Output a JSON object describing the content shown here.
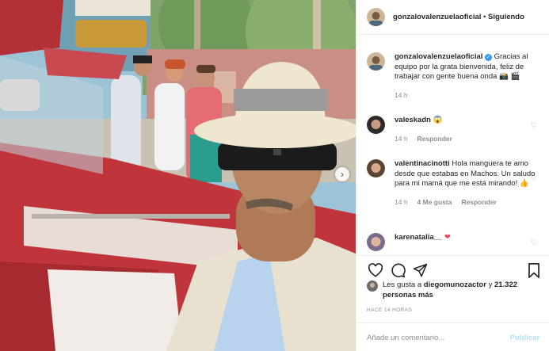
{
  "post": {
    "username": "gonzalovalenzuelaoficial",
    "follow_separator": "•",
    "follow_status": "Siguiendo"
  },
  "photo_next_icon": "chevron-right-icon",
  "comments": [
    {
      "username": "gonzalovalenzuelaoficial",
      "verified": true,
      "text": "Gracias al equipo por la grata bienvenida, feliz de trabajar con gente buena onda 📸 🎬",
      "time": "14 h"
    },
    {
      "username": "valeskadn",
      "text": "😱",
      "time": "14 h",
      "reply": "Responder"
    },
    {
      "username": "valentinacinotti",
      "text": "Hola manguera te amo desde que estabas en Machos. Un saludo para mi mamá que me está mirando! 👍",
      "time": "14 h",
      "likes": "4 Me gusta",
      "reply": "Responder"
    },
    {
      "username": "karenatalia__",
      "text": "❤"
    }
  ],
  "likes": {
    "prefix": "Les gusta a",
    "user": "diegomunozactor",
    "connector": "y",
    "count": "21.322 personas más"
  },
  "time_ago": "HACE 14 HORAS",
  "add_comment": {
    "placeholder": "Añade un comentario...",
    "publish": "Publicar"
  },
  "colors": {
    "accent_blue": "#3897f0",
    "publish_disabled": "#b2dffc",
    "muted": "#8e8e8e",
    "heart_red": "#ed4956"
  }
}
